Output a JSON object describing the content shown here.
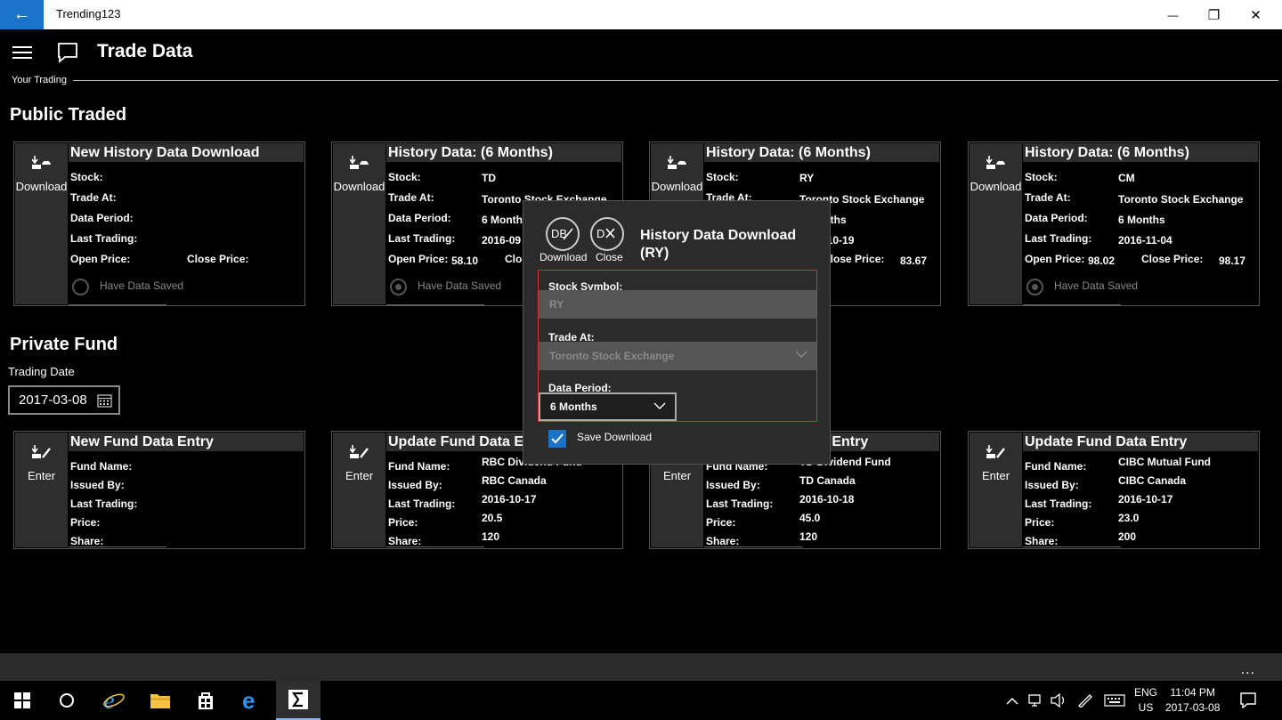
{
  "window": {
    "app_title": "Trending123",
    "back_glyph": "←",
    "minimize_glyph": "—",
    "restore_glyph": "❐",
    "close_glyph": "✕"
  },
  "header": {
    "title": "Trade Data",
    "sub_nav": "Your Trading"
  },
  "sections": {
    "public": "Public Traded",
    "private": "Private Fund"
  },
  "trading_date": {
    "label": "Trading Date",
    "value": "2017-03-08"
  },
  "labels": {
    "stock": "Stock:",
    "trade_at": "Trade At:",
    "data_period": "Data Period:",
    "last_trading": "Last Trading:",
    "open_price": "Open Price:",
    "close_price": "Close Price:",
    "have_saved": "Have Data Saved",
    "fund_name": "Fund Name:",
    "issued_by": "Issued By:",
    "price": "Price:",
    "share": "Share:"
  },
  "public_cards": [
    {
      "action": "Download",
      "title": "New History Data Download",
      "stock": "",
      "trade_at": "",
      "period": "",
      "last": "",
      "open": "",
      "close": "",
      "saved": false
    },
    {
      "action": "Download",
      "title": "History Data: (6 Months)",
      "stock": "TD",
      "trade_at": "Toronto Stock Exchange",
      "period": "6 Months",
      "last": "2016-09",
      "open": "58.10",
      "close": "",
      "saved": true
    },
    {
      "action": "Download",
      "title": "History Data: (6 Months)",
      "stock": "RY",
      "trade_at": "Toronto Stock Exchange",
      "period": "6 Months",
      "last": "2016-10-19",
      "open": "",
      "close": "83.67",
      "saved": true
    },
    {
      "action": "Download",
      "title": "History Data: (6 Months)",
      "stock": "CM",
      "trade_at": "Toronto Stock Exchange",
      "period": "6 Months",
      "last": "2016-11-04",
      "open": "98.02",
      "close": "98.17",
      "saved": true
    }
  ],
  "fund_cards": [
    {
      "action": "Enter",
      "title": "New Fund Data Entry",
      "fund": "",
      "issued": "",
      "last": "",
      "price": "",
      "share": ""
    },
    {
      "action": "Enter",
      "title": "Update Fund Data Entry",
      "fund": "RBC Dividend Fund",
      "issued": "RBC Canada",
      "last": "2016-10-17",
      "price": "20.5",
      "share": "120"
    },
    {
      "action": "Enter",
      "title": "Update Fund Data Entry",
      "fund": "TD Dividend Fund",
      "issued": "TD Canada",
      "last": "2016-10-18",
      "price": "45.0",
      "share": "120"
    },
    {
      "action": "Enter",
      "title": "Update Fund Data Entry",
      "fund": "CIBC Mutual Fund",
      "issued": "CIBC Canada",
      "last": "2016-10-17",
      "price": "23.0",
      "share": "200"
    }
  ],
  "dialog": {
    "download_label": "Download",
    "close_label": "Close",
    "title_line1": "History Data Download",
    "title_line2": "(RY)",
    "symbol_label": "Stock Symbol:",
    "symbol_value": "RY",
    "trade_at_label": "Trade At:",
    "trade_at_value": "Toronto Stock Exchange",
    "period_label": "Data Period:",
    "period_value": "6 Months",
    "save_label": "Save Download",
    "save_checked": true
  },
  "appbar": {
    "more": "..."
  },
  "taskbar": {
    "lang1": "ENG",
    "lang2": "US",
    "time": "11:04 PM",
    "date": "2017-03-08"
  },
  "colors": {
    "accent": "#1a73c8",
    "error_border": "#d32f2f",
    "card_bg": "#2e2e2e"
  }
}
